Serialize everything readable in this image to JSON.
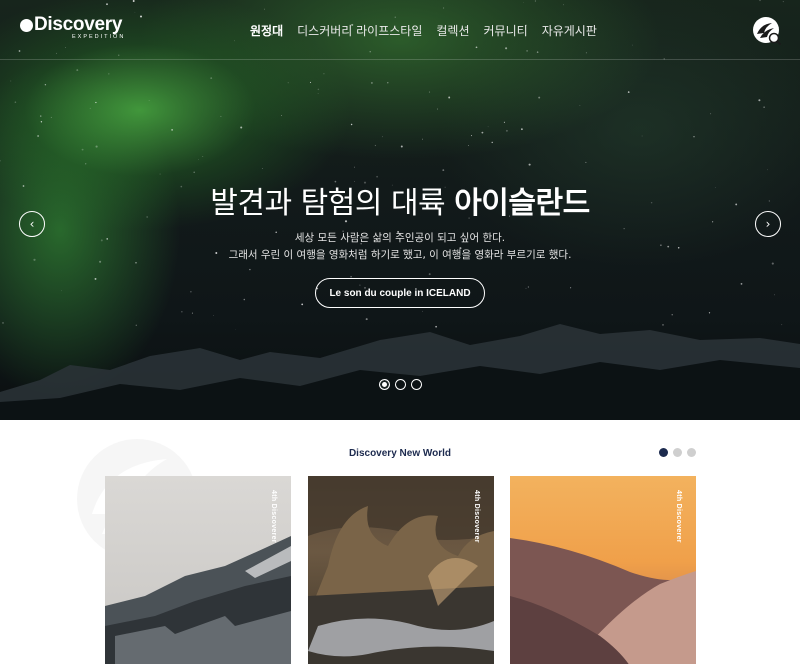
{
  "brand": {
    "name": "Discovery",
    "sub": "EXPEDITION"
  },
  "nav": {
    "items": [
      {
        "label": "원정대",
        "active": true
      },
      {
        "label": "디스커버리 라이프스타일",
        "active": false
      },
      {
        "label": "컬렉션",
        "active": false
      },
      {
        "label": "커뮤니티",
        "active": false
      },
      {
        "label": "자유게시판",
        "active": false
      }
    ]
  },
  "hero": {
    "title_light": "발견과 탐험의 대륙",
    "title_bold": "아이슬란드",
    "desc_line1": "세상 모든 사람은 삶의 주인공이 되고 싶어 한다.",
    "desc_line2": "그래서 우린 이 여행을 영화처럼 하기로 했고, 이 여행을 영화라 부르기로 했다.",
    "cta_label": "Le son du couple in ICELAND",
    "prev_icon": "chevron-left-icon",
    "next_icon": "chevron-right-icon",
    "prev_glyph": "‹",
    "next_glyph": "›",
    "slides": [
      {
        "active": true
      },
      {
        "active": false
      },
      {
        "active": false
      }
    ]
  },
  "section": {
    "title": "Discovery New World",
    "pages": [
      {
        "active": true
      },
      {
        "active": false
      },
      {
        "active": false
      }
    ],
    "cards": [
      {
        "label": "4th Discoverer",
        "theme": "snow-mountain"
      },
      {
        "label": "4th Discoverer",
        "theme": "winter-shrubs"
      },
      {
        "label": "4th Discoverer",
        "theme": "desert-dune"
      }
    ]
  },
  "colors": {
    "navy": "#1c2a4e",
    "aurora": "#4fb548",
    "white": "#ffffff"
  }
}
